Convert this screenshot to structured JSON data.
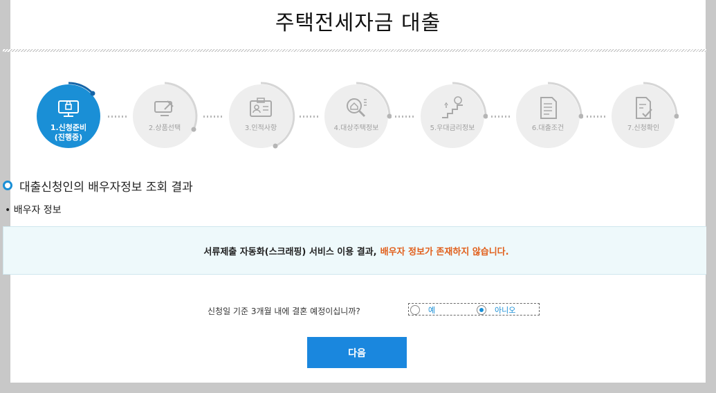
{
  "page": {
    "title": "주택전세자금 대출"
  },
  "steps": [
    {
      "label": "1.신청준비",
      "sub": "(진행중)",
      "icon": "computer-lock-icon",
      "active": true
    },
    {
      "label": "2.상품선택",
      "sub": "",
      "icon": "product-select-icon",
      "active": false
    },
    {
      "label": "3.인적사항",
      "sub": "",
      "icon": "id-card-icon",
      "active": false
    },
    {
      "label": "4.대상주택정보",
      "sub": "",
      "icon": "house-search-icon",
      "active": false
    },
    {
      "label": "5.우대금리정보",
      "sub": "",
      "icon": "rate-stairs-icon",
      "active": false
    },
    {
      "label": "6.대출조건",
      "sub": "",
      "icon": "document-list-icon",
      "active": false
    },
    {
      "label": "7.신청확인",
      "sub": "",
      "icon": "document-check-icon",
      "active": false
    }
  ],
  "section": {
    "title": "대출신청인의 배우자정보 조회 결과",
    "subtitle": "배우자 정보"
  },
  "notice": {
    "text": "서류제출 자동화(스크래핑) 서비스 이용 결과,",
    "warning": "배우자 정보가 존재하지 않습니다."
  },
  "question": {
    "text": "신청일 기준 3개월 내에 결혼 예정이십니까?",
    "options": [
      "예",
      "아니오"
    ],
    "selected": "아니오"
  },
  "buttons": {
    "next": "다음"
  },
  "colors": {
    "accent": "#1a8fd6",
    "warning": "#e15f1b",
    "notice_bg": "#eef9fb"
  }
}
